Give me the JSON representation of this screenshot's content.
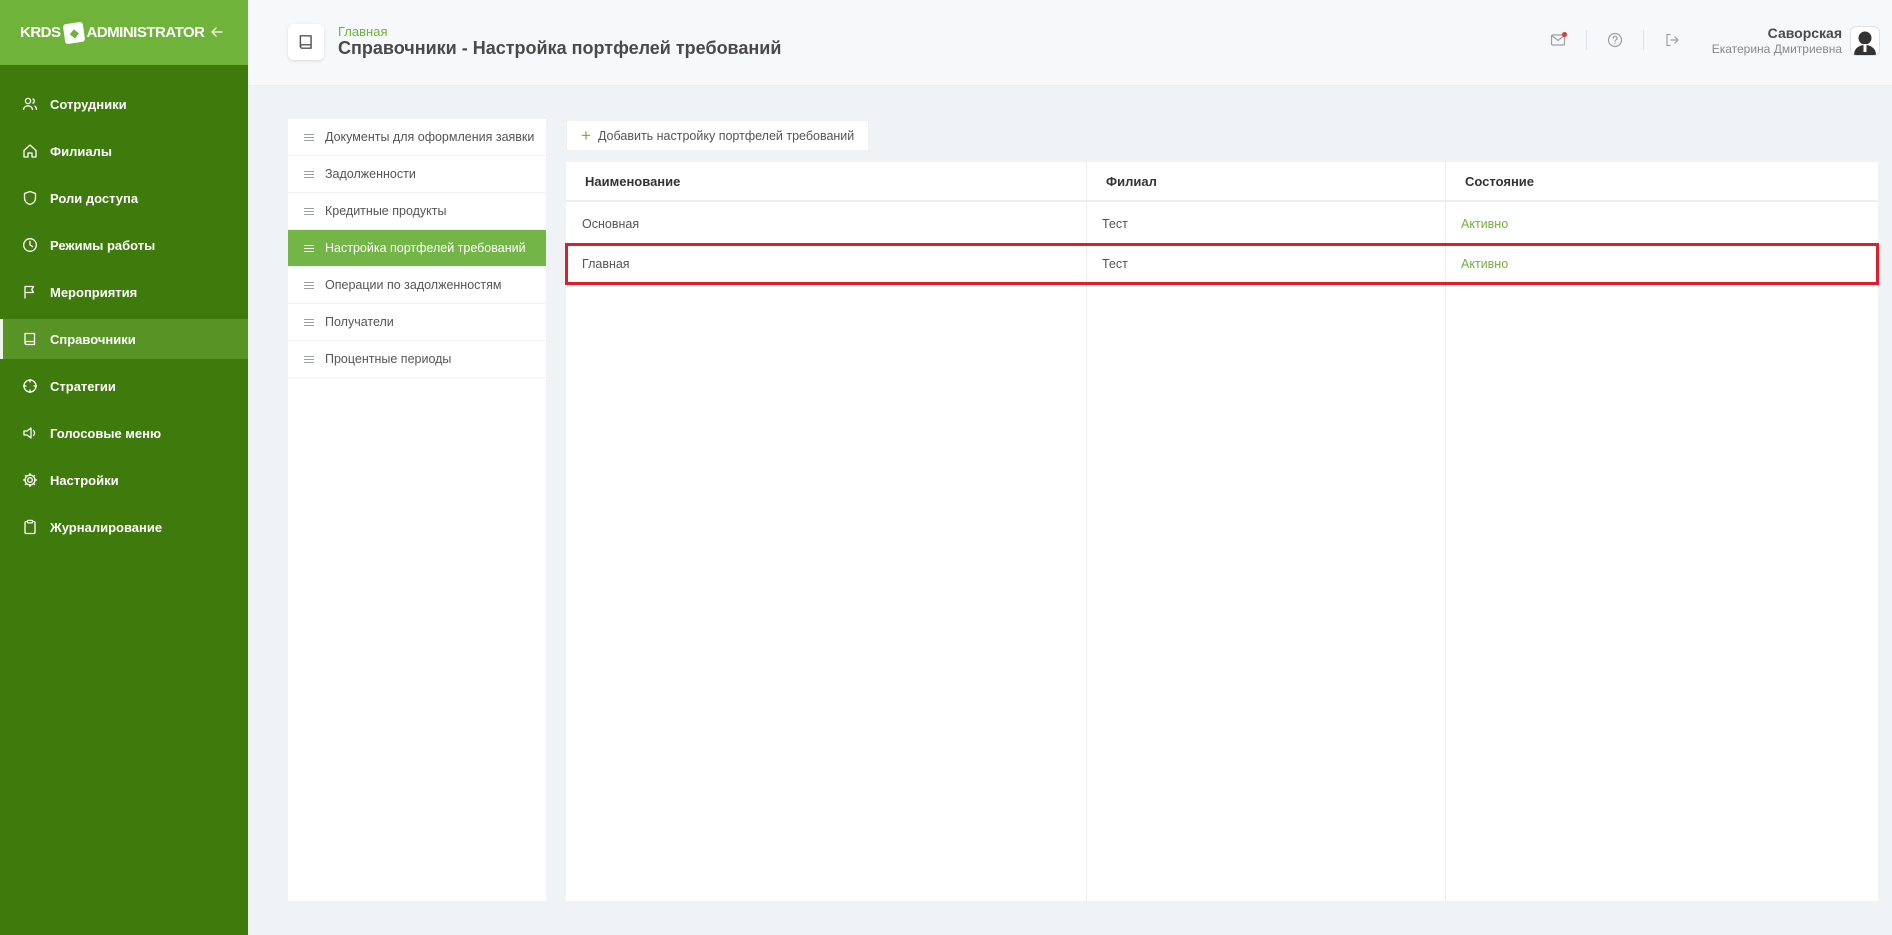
{
  "app": {
    "logo_left": "KRDS",
    "logo_right": "ADMINISTRATOR",
    "collapse_icon": "arrow-left-icon"
  },
  "sidebar": {
    "items": [
      {
        "label": "Сотрудники",
        "icon": "users-icon"
      },
      {
        "label": "Филиалы",
        "icon": "home-icon"
      },
      {
        "label": "Роли доступа",
        "icon": "shield-icon"
      },
      {
        "label": "Режимы работы",
        "icon": "clock-icon"
      },
      {
        "label": "Мероприятия",
        "icon": "flag-icon"
      },
      {
        "label": "Справочники",
        "icon": "book-icon",
        "active": true
      },
      {
        "label": "Стратегии",
        "icon": "crosshair-icon"
      },
      {
        "label": "Голосовые меню",
        "icon": "speaker-icon"
      },
      {
        "label": "Настройки",
        "icon": "gear-icon"
      },
      {
        "label": "Журналирование",
        "icon": "clipboard-icon"
      }
    ]
  },
  "header": {
    "breadcrumb": "Главная",
    "title": "Справочники - Настройка портфелей требований",
    "icons": [
      "mail-icon",
      "help-icon",
      "logout-icon"
    ],
    "user": {
      "last_name": "Саворская",
      "first_name": "Екатерина Дмитриевна"
    }
  },
  "submenu": {
    "items": [
      {
        "label": "Документы для оформления заявки"
      },
      {
        "label": "Задолженности"
      },
      {
        "label": "Кредитные продукты"
      },
      {
        "label": "Настройка портфелей требований",
        "active": true
      },
      {
        "label": "Операции по задолженностям"
      },
      {
        "label": "Получатели"
      },
      {
        "label": "Процентные периоды"
      }
    ]
  },
  "toolbar": {
    "add_label": "Добавить настройку портфелей требований"
  },
  "table": {
    "columns": [
      "Наименование",
      "Филиал",
      "Состояние"
    ],
    "rows": [
      {
        "name": "Основная",
        "branch": "Тест",
        "status": "Активно"
      },
      {
        "name": "Главная",
        "branch": "Тест",
        "status": "Активно",
        "highlighted": true
      }
    ]
  },
  "colors": {
    "sidebar_bg": "#3e7a0c",
    "sidebar_header": "#6fb33a",
    "accent": "#6fb33a",
    "highlight_border": "#e01e2b"
  }
}
